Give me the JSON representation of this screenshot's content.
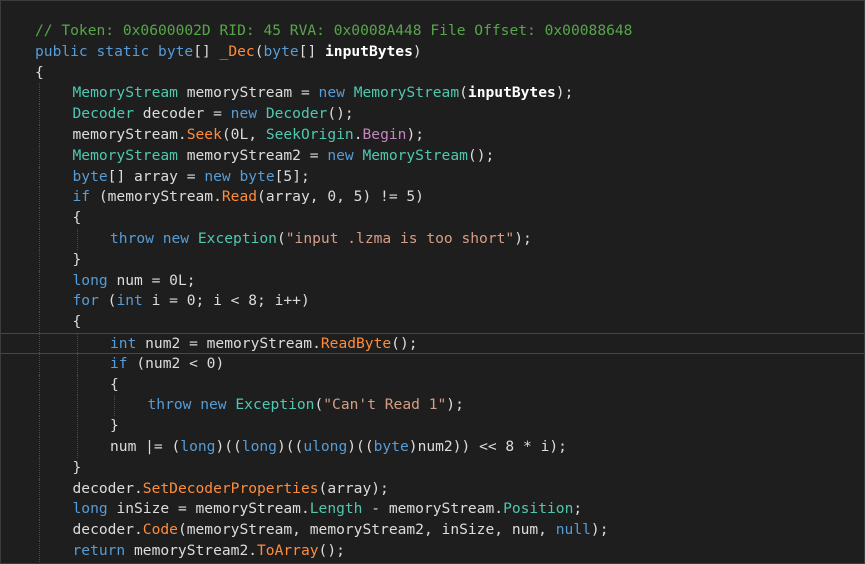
{
  "editor": {
    "current_line_index": 15,
    "lines": [
      {
        "indent": 1,
        "tokens": [
          [
            "comment",
            "// Token: 0x0600002D RID: 45 RVA: 0x0008A448 File Offset: 0x00088648"
          ]
        ]
      },
      {
        "indent": 1,
        "tokens": [
          [
            "keyword",
            "public"
          ],
          [
            "plain",
            " "
          ],
          [
            "keyword",
            "static"
          ],
          [
            "plain",
            " "
          ],
          [
            "keyword",
            "byte"
          ],
          [
            "plain",
            "[] "
          ],
          [
            "method",
            "_Dec"
          ],
          [
            "plain",
            "("
          ],
          [
            "keyword",
            "byte"
          ],
          [
            "plain",
            "[] "
          ],
          [
            "param",
            "inputBytes"
          ],
          [
            "plain",
            ")"
          ]
        ]
      },
      {
        "indent": 1,
        "tokens": [
          [
            "plain",
            "{"
          ]
        ]
      },
      {
        "indent": 2,
        "tokens": [
          [
            "type",
            "MemoryStream"
          ],
          [
            "plain",
            " memoryStream = "
          ],
          [
            "keyword",
            "new"
          ],
          [
            "plain",
            " "
          ],
          [
            "type",
            "MemoryStream"
          ],
          [
            "plain",
            "("
          ],
          [
            "param",
            "inputBytes"
          ],
          [
            "plain",
            ");"
          ]
        ]
      },
      {
        "indent": 2,
        "tokens": [
          [
            "type",
            "Decoder"
          ],
          [
            "plain",
            " decoder = "
          ],
          [
            "keyword",
            "new"
          ],
          [
            "plain",
            " "
          ],
          [
            "type",
            "Decoder"
          ],
          [
            "plain",
            "();"
          ]
        ]
      },
      {
        "indent": 2,
        "tokens": [
          [
            "plain",
            "memoryStream."
          ],
          [
            "method",
            "Seek"
          ],
          [
            "plain",
            "(0L, "
          ],
          [
            "type",
            "SeekOrigin"
          ],
          [
            "plain",
            "."
          ],
          [
            "enummember",
            "Begin"
          ],
          [
            "plain",
            ");"
          ]
        ]
      },
      {
        "indent": 2,
        "tokens": [
          [
            "type",
            "MemoryStream"
          ],
          [
            "plain",
            " memoryStream2 = "
          ],
          [
            "keyword",
            "new"
          ],
          [
            "plain",
            " "
          ],
          [
            "type",
            "MemoryStream"
          ],
          [
            "plain",
            "();"
          ]
        ]
      },
      {
        "indent": 2,
        "tokens": [
          [
            "keyword",
            "byte"
          ],
          [
            "plain",
            "[] array = "
          ],
          [
            "keyword",
            "new"
          ],
          [
            "plain",
            " "
          ],
          [
            "keyword",
            "byte"
          ],
          [
            "plain",
            "[5];"
          ]
        ]
      },
      {
        "indent": 2,
        "tokens": [
          [
            "keyword",
            "if"
          ],
          [
            "plain",
            " (memoryStream."
          ],
          [
            "method",
            "Read"
          ],
          [
            "plain",
            "(array, 0, 5) != 5)"
          ]
        ]
      },
      {
        "indent": 2,
        "tokens": [
          [
            "plain",
            "{"
          ]
        ]
      },
      {
        "indent": 3,
        "tokens": [
          [
            "keyword",
            "throw"
          ],
          [
            "plain",
            " "
          ],
          [
            "keyword",
            "new"
          ],
          [
            "plain",
            " "
          ],
          [
            "type",
            "Exception"
          ],
          [
            "plain",
            "("
          ],
          [
            "string",
            "\"input .lzma is too short\""
          ],
          [
            "plain",
            ");"
          ]
        ]
      },
      {
        "indent": 2,
        "tokens": [
          [
            "plain",
            "}"
          ]
        ]
      },
      {
        "indent": 2,
        "tokens": [
          [
            "keyword",
            "long"
          ],
          [
            "plain",
            " num = 0L;"
          ]
        ]
      },
      {
        "indent": 2,
        "tokens": [
          [
            "keyword",
            "for"
          ],
          [
            "plain",
            " ("
          ],
          [
            "keyword",
            "int"
          ],
          [
            "plain",
            " i = 0; i < 8; i++)"
          ]
        ]
      },
      {
        "indent": 2,
        "tokens": [
          [
            "plain",
            "{"
          ]
        ]
      },
      {
        "indent": 3,
        "tokens": [
          [
            "keyword",
            "int"
          ],
          [
            "plain",
            " num2 = memoryStream."
          ],
          [
            "method",
            "ReadByte"
          ],
          [
            "plain",
            "();"
          ]
        ]
      },
      {
        "indent": 3,
        "tokens": [
          [
            "keyword",
            "if"
          ],
          [
            "plain",
            " (num2 < 0)"
          ]
        ]
      },
      {
        "indent": 3,
        "tokens": [
          [
            "plain",
            "{"
          ]
        ]
      },
      {
        "indent": 4,
        "tokens": [
          [
            "keyword",
            "throw"
          ],
          [
            "plain",
            " "
          ],
          [
            "keyword",
            "new"
          ],
          [
            "plain",
            " "
          ],
          [
            "type",
            "Exception"
          ],
          [
            "plain",
            "("
          ],
          [
            "string",
            "\"Can't Read 1\""
          ],
          [
            "plain",
            ");"
          ]
        ]
      },
      {
        "indent": 3,
        "tokens": [
          [
            "plain",
            "}"
          ]
        ]
      },
      {
        "indent": 3,
        "tokens": [
          [
            "plain",
            "num |= ("
          ],
          [
            "keyword",
            "long"
          ],
          [
            "plain",
            ")(("
          ],
          [
            "keyword",
            "long"
          ],
          [
            "plain",
            ")(("
          ],
          [
            "keyword",
            "ulong"
          ],
          [
            "plain",
            ")(("
          ],
          [
            "keyword",
            "byte"
          ],
          [
            "plain",
            ")num2)) << 8 * i);"
          ]
        ]
      },
      {
        "indent": 2,
        "tokens": [
          [
            "plain",
            "}"
          ]
        ]
      },
      {
        "indent": 2,
        "tokens": [
          [
            "plain",
            "decoder."
          ],
          [
            "method",
            "SetDecoderProperties"
          ],
          [
            "plain",
            "(array);"
          ]
        ]
      },
      {
        "indent": 2,
        "tokens": [
          [
            "keyword",
            "long"
          ],
          [
            "plain",
            " inSize = memoryStream."
          ],
          [
            "prop",
            "Length"
          ],
          [
            "plain",
            " - memoryStream."
          ],
          [
            "prop",
            "Position"
          ],
          [
            "plain",
            ";"
          ]
        ]
      },
      {
        "indent": 2,
        "tokens": [
          [
            "plain",
            "decoder."
          ],
          [
            "method",
            "Code"
          ],
          [
            "plain",
            "(memoryStream, memoryStream2, inSize, num, "
          ],
          [
            "keyword",
            "null"
          ],
          [
            "plain",
            ");"
          ]
        ]
      },
      {
        "indent": 2,
        "tokens": [
          [
            "keyword",
            "return"
          ],
          [
            "plain",
            " memoryStream2."
          ],
          [
            "method",
            "ToArray"
          ],
          [
            "plain",
            "();"
          ]
        ]
      },
      {
        "indent": 1,
        "tokens": [
          [
            "plain",
            "}"
          ]
        ]
      }
    ]
  }
}
